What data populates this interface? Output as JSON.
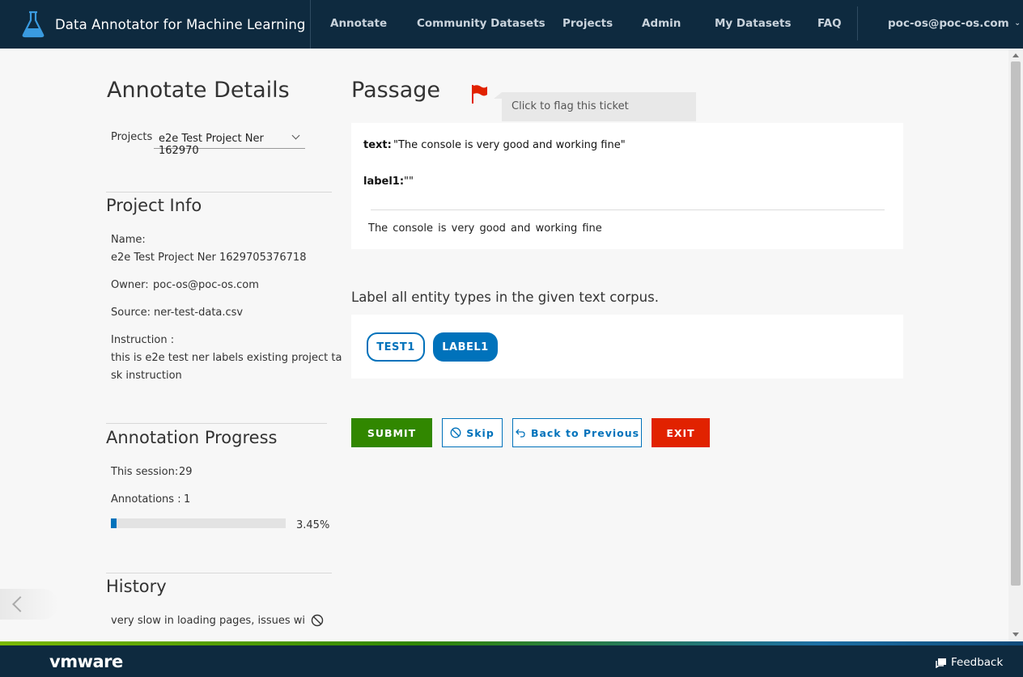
{
  "header": {
    "app_title": "Data Annotator for Machine Learning",
    "nav": [
      "Annotate",
      "Community Datasets",
      "Projects",
      "Admin",
      "My Datasets",
      "FAQ"
    ],
    "user": "poc-os@poc-os.com"
  },
  "details": {
    "title": "Annotate Details",
    "projects_label": "Projects",
    "project_selected": "e2e Test Project Ner 162970"
  },
  "project_info": {
    "title": "Project Info",
    "name_label": "Name:",
    "name_value": "e2e Test Project Ner 1629705376718",
    "owner_label": "Owner:",
    "owner_value": "poc-os@poc-os.com",
    "source_label": "Source:",
    "source_value": "ner-test-data.csv",
    "instruction_label": "Instruction :",
    "instruction_line1": "this is e2e test ner labels existing project ta",
    "instruction_line2": "sk instruction"
  },
  "progress": {
    "title": "Annotation Progress",
    "session_label": "This session:",
    "session_value": "29",
    "annotations_label": "Annotations :",
    "annotations_value": "1",
    "percent_label": "3.45%",
    "fraction": 0.0345
  },
  "history": {
    "title": "History",
    "item": "very slow in loading pages, issues wi"
  },
  "passage": {
    "title": "Passage",
    "flag_tooltip": "Click to flag this ticket",
    "text_key": "text:",
    "text_value": "\"The console is very good and working fine\"",
    "label_key": "label1:",
    "label_value": "\"\"",
    "body": "The console is very good and working fine"
  },
  "labeling": {
    "instruction": "Label all entity types in the given text corpus.",
    "labels": [
      "TEST1",
      "LABEL1"
    ]
  },
  "actions": {
    "submit": "SUBMIT",
    "skip": "Skip",
    "back": "Back to Previous",
    "exit": "EXIT"
  },
  "footer": {
    "logo": "vmware",
    "feedback": "Feedback"
  },
  "colors": {
    "header_bg": "#0e2a3f",
    "accent_blue": "#0072bb",
    "submit_green": "#318700",
    "exit_red": "#e12200",
    "flag_red": "#e12200"
  }
}
